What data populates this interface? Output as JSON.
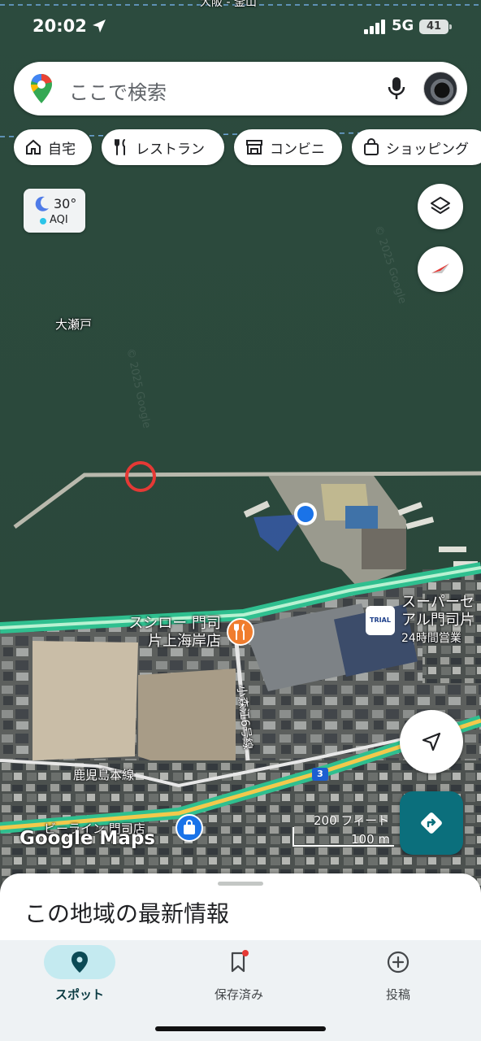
{
  "status_bar": {
    "time": "20:02",
    "network": "5G",
    "battery": "41"
  },
  "search": {
    "placeholder": "ここで検索",
    "icons": [
      "google-maps-pin-icon",
      "mic-icon",
      "profile-avatar"
    ]
  },
  "chips": [
    {
      "label": "自宅",
      "icon": "home-icon"
    },
    {
      "label": "レストラン",
      "icon": "fork-knife-icon"
    },
    {
      "label": "コンビニ",
      "icon": "store-icon"
    },
    {
      "label": "ショッピング",
      "icon": "shopping-bag-icon"
    }
  ],
  "weather": {
    "temperature": "30°",
    "aqi_label": "AQI",
    "icon": "moon-icon"
  },
  "map": {
    "top_road_label": "大阪 - 釜山",
    "water_label": "大瀬戸",
    "watermark": "© 2025 Google",
    "places": {
      "sushiro_line1": "スシロー 門司",
      "sushiro_line2": "片上海岸店",
      "trial_line1": "スーパーセ",
      "trial_line2": "アル門司片",
      "trial_hours": "24時間営業",
      "trial_logo": "TRIAL",
      "beeline": "ビーライン 門司店"
    },
    "road_labels": {
      "kamori": "小森江6号線",
      "kagoshima": "鹿児島本線",
      "route_shield": "3"
    },
    "scale": {
      "feet": "200 フィート",
      "meters": "100 m"
    },
    "branding": "Google Maps",
    "colors": {
      "water": "#2e4a3d",
      "road": "#2fbf8f",
      "road_yellow": "#f2c94c",
      "restaurant_pin": "#f07d2e",
      "shopping_pin": "#1a73e8",
      "my_location": "#1a73e8",
      "directions_button": "#0b6f7c"
    }
  },
  "buttons": {
    "layers": "layers-icon",
    "compass": "compass-icon",
    "my_location": "navigation-arrow-icon",
    "directions": "directions-icon"
  },
  "sheet": {
    "title": "この地域の最新情報"
  },
  "nav": [
    {
      "label": "スポット",
      "icon": "place-pin-icon",
      "active": true
    },
    {
      "label": "保存済み",
      "icon": "bookmark-icon",
      "active": false,
      "badge": true
    },
    {
      "label": "投稿",
      "icon": "add-circle-icon",
      "active": false
    }
  ]
}
